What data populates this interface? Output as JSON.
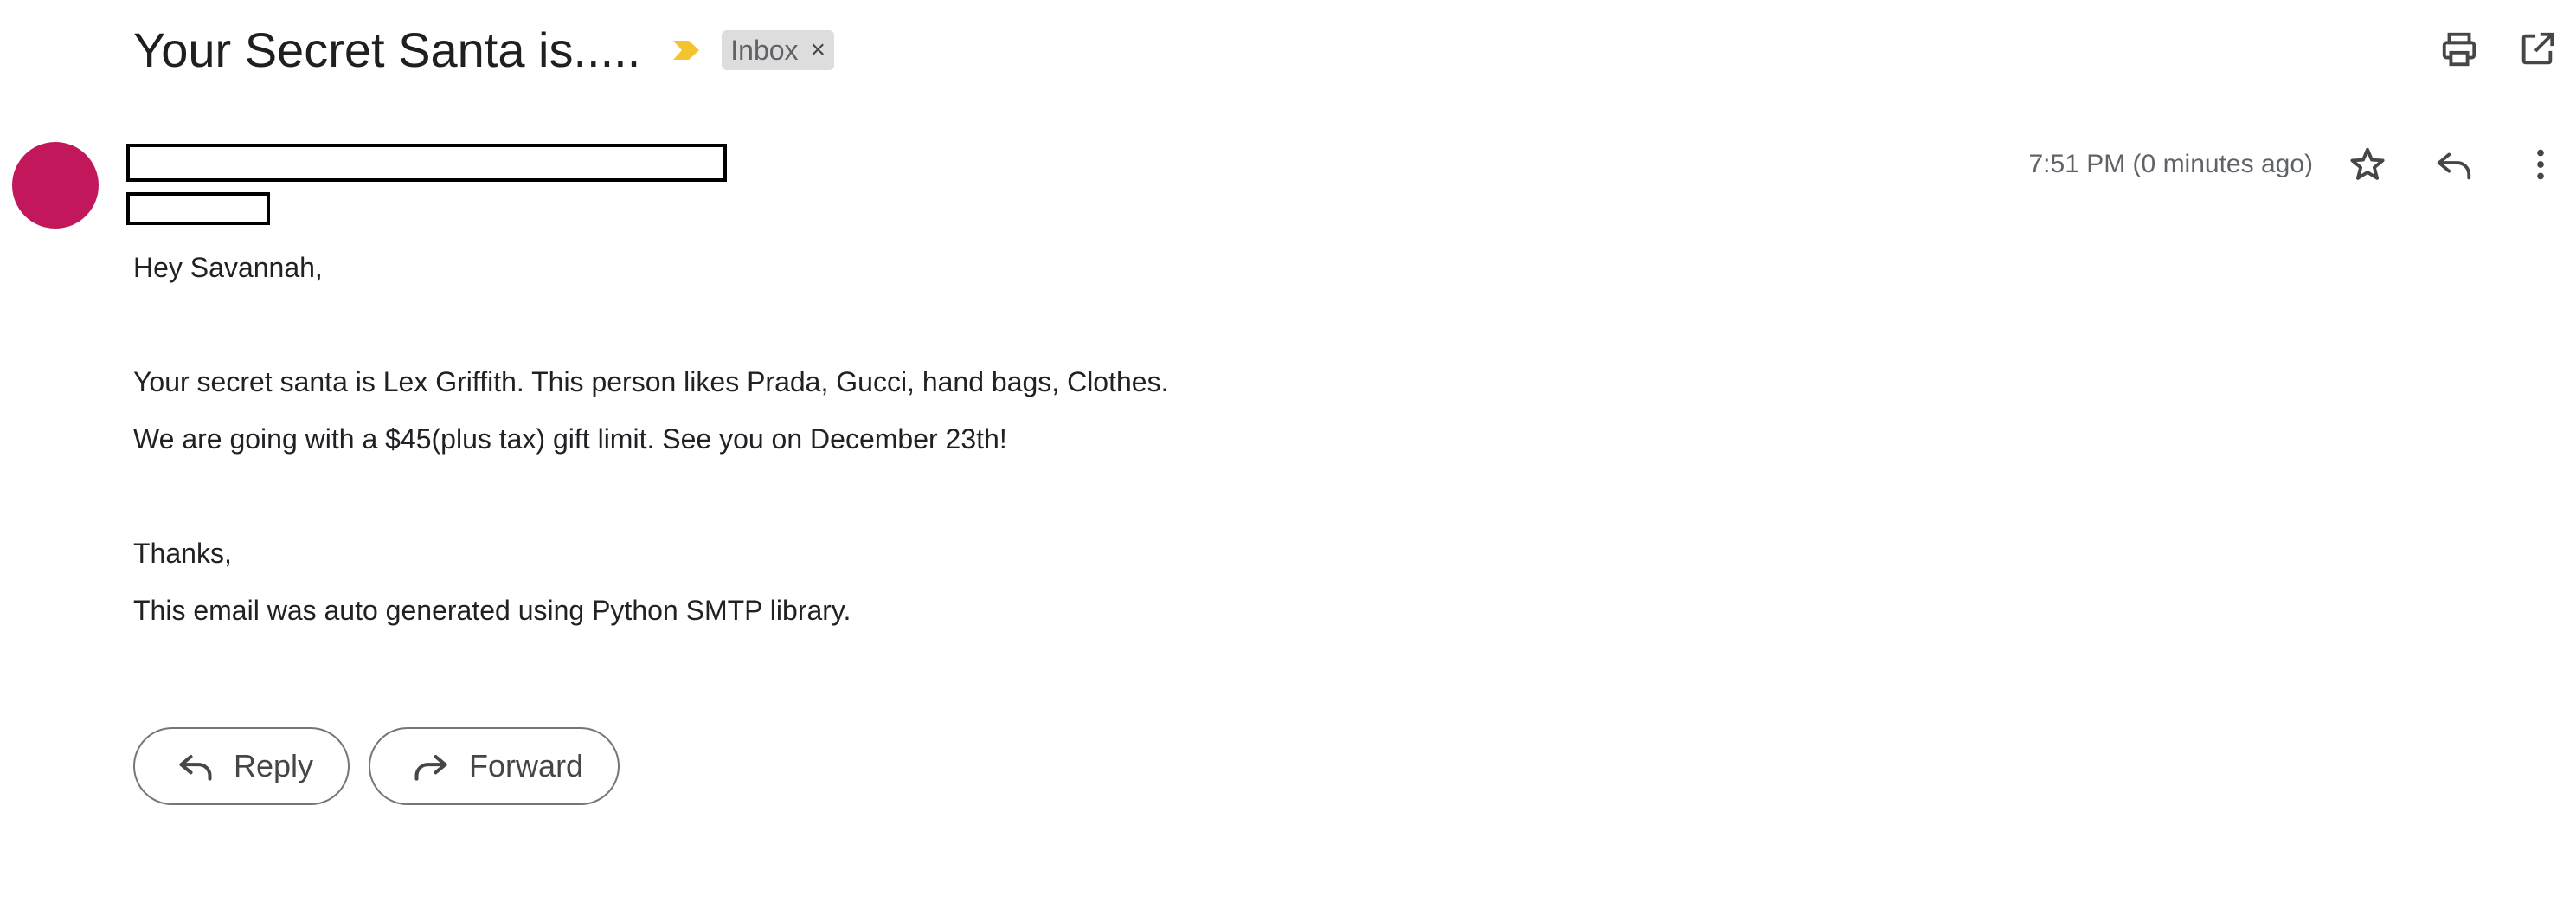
{
  "email": {
    "subject": "Your Secret Santa is.....",
    "label": "Inbox",
    "label_remove": "×",
    "timestamp": "7:51 PM (0 minutes ago)",
    "body": {
      "greeting": "Hey Savannah,",
      "line1": "Your secret santa is Lex Griffith. This person likes Prada, Gucci, hand bags, Clothes.",
      "line2": "We are going with a $45(plus tax) gift limit. See you on December 23th!",
      "signoff": "Thanks,",
      "footer": "This email was auto generated using Python SMTP library."
    }
  },
  "actions": {
    "reply_label": "Reply",
    "forward_label": "Forward"
  },
  "icons": {
    "importance": "importance-marker-icon",
    "print": "print-icon",
    "new_window": "open-in-new-window-icon",
    "star": "star-icon",
    "reply": "reply-icon",
    "more": "more-vertical-icon",
    "forward": "forward-icon"
  },
  "colors": {
    "avatar": "#c2185b",
    "importance": "#f4c430",
    "label_chip": "#dddddd"
  }
}
